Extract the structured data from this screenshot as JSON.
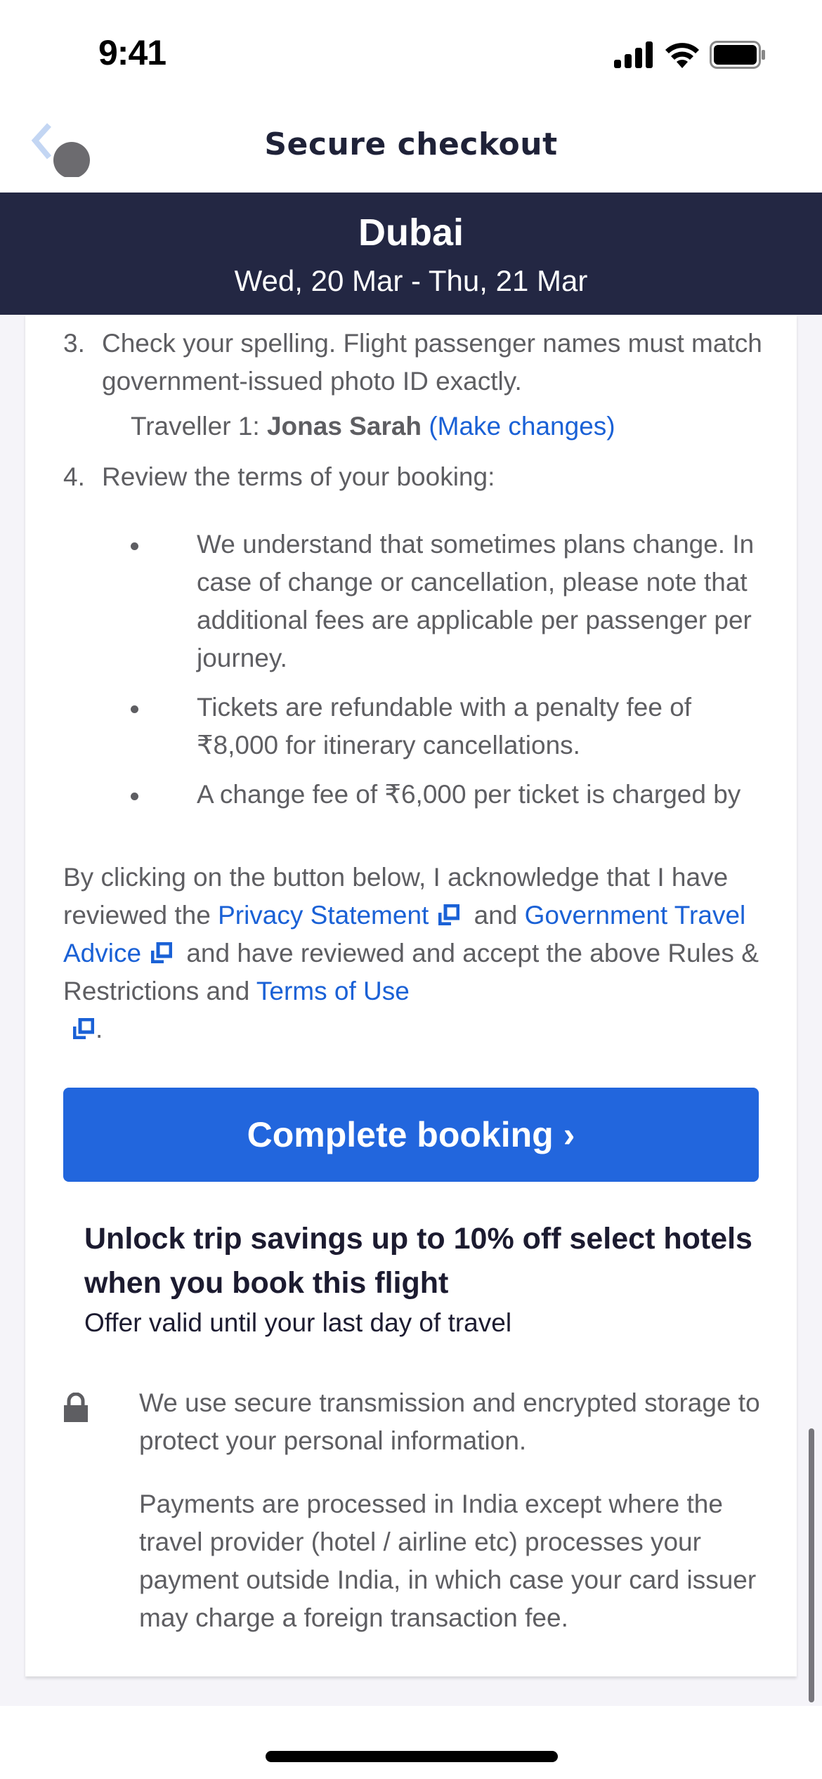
{
  "status_bar": {
    "time": "9:41",
    "icons": [
      "signal-icon",
      "wifi-icon",
      "battery-icon"
    ]
  },
  "nav": {
    "title": "Secure checkout",
    "back_icon": "chevron-left-icon"
  },
  "trip": {
    "city": "Dubai",
    "dates": "Wed, 20 Mar - Thu, 21 Mar"
  },
  "steps": [
    {
      "number": "3.",
      "text": "Check your spelling. Flight passenger names must match government-issued photo ID exactly."
    },
    {
      "number": "4.",
      "text": "Review the terms of your booking:"
    }
  ],
  "traveller": {
    "label": "Traveller 1:",
    "name": "Jonas Sarah",
    "link": "(Make changes)"
  },
  "terms_bullets": [
    "We understand that sometimes plans change. In case of change or cancellation, please note that additional fees are applicable per passenger per journey.",
    "Tickets are refundable with a penalty fee of ₹8,000 for itinerary cancellations.",
    "A change fee of ₹6,000 per ticket is charged by"
  ],
  "acknowledgement": {
    "part1": "By clicking on the button below, I acknowledge that I have reviewed the ",
    "privacy_link": "Privacy Statement",
    "part2": " and ",
    "gov_link": "Government Travel Advice",
    "part3": " and have reviewed and accept the above Rules & Restrictions and ",
    "terms_link": "Terms of Use",
    "part4": "."
  },
  "cta": {
    "label": "Complete booking",
    "chevron": "›"
  },
  "promo": {
    "title": "Unlock trip savings up to 10% off select hotels when you book this flight",
    "subtitle": "Offer valid until your last day of travel"
  },
  "security": {
    "text1": "We use secure transmission and encrypted storage to protect your personal information.",
    "text2": "Payments are processed in India except where the travel provider (hotel / airline etc) processes your payment outside India, in which case your card issuer may charge a foreign transaction fee."
  },
  "colors": {
    "header_bg": "#232743",
    "link": "#1a61d6",
    "cta_bg": "#2266dd",
    "body_text": "#5e5e62",
    "dark_text": "#1c1b30",
    "page_bg": "#f5f4f9"
  }
}
